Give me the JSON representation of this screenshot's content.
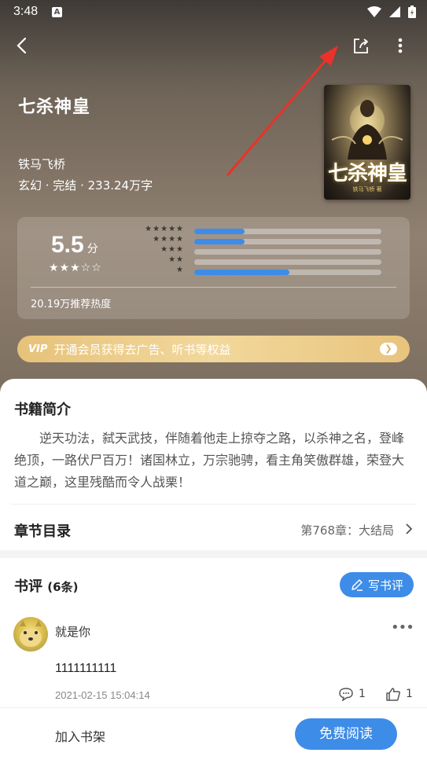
{
  "status_bar": {
    "time": "3:48",
    "notification_icon": "A"
  },
  "book": {
    "title": "七杀神皇",
    "author": "铁马飞桥",
    "meta": "玄幻 · 完结 · 233.24万字",
    "cover_title": "七杀神皇",
    "cover_subtitle": "铁马飞桥 著"
  },
  "rating": {
    "score": "5.5",
    "unit": "分",
    "stars_display": "★★★☆☆",
    "hot_text": "20.19万推荐热度",
    "distribution": [
      {
        "stars": "★★★★★",
        "fraction": 0.27
      },
      {
        "stars": "★★★★",
        "fraction": 0.27
      },
      {
        "stars": "★★★",
        "fraction": 0.0
      },
      {
        "stars": "★★",
        "fraction": 0.0
      },
      {
        "stars": "★",
        "fraction": 0.51
      }
    ]
  },
  "vip": {
    "badge": "VIP",
    "text": "开通会员获得去广告、听书等权益"
  },
  "intro": {
    "title": "书籍简介",
    "text": "逆天功法，弑天武技，伴随着他走上掠夺之路，以杀神之名，登峰绝顶，一路伏尸百万！诸国林立，万宗驰骋，看主角笑傲群雄，荣登大道之巅，这里残酷而令人战栗！"
  },
  "chapters": {
    "title": "章节目录",
    "latest": "第768章：大结局"
  },
  "reviews": {
    "title": "书评",
    "count": "(6条)",
    "write_label": "写书评",
    "items": [
      {
        "user": "就是你",
        "content": "1111111111",
        "time": "2021-02-15 15:04:14",
        "comments": "1",
        "likes": "1"
      }
    ]
  },
  "bottom": {
    "shelf_label": "加入书架",
    "read_label": "免费阅读"
  },
  "colors": {
    "accent": "#3d8ce8",
    "vip_gold": "#e6c27a",
    "annotation_arrow": "#e8322a"
  },
  "icons": [
    "back-arrow-icon",
    "share-icon",
    "more-vertical-icon",
    "chevron-right-icon",
    "edit-pen-icon",
    "comment-icon",
    "thumbs-up-icon",
    "more-horizontal-icon",
    "wifi-icon",
    "signal-icon",
    "battery-icon"
  ]
}
